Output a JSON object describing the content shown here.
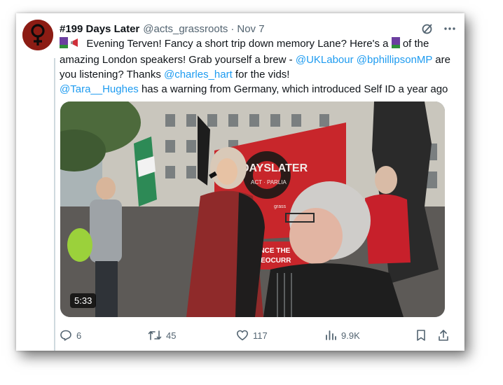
{
  "tweet": {
    "author_name": "#199 Days Later",
    "handle": "@acts_grassroots",
    "separator": "·",
    "date": "Nov 7",
    "text": {
      "l1_a": "Evening Terven! Fancy a short trip down memory Lane? Here's a ",
      "l1_b": " of the",
      "l2_a": "amazing London speakers! Grab yourself a brew - ",
      "l2_link1": "@UKLabour",
      "l2_link2": "@bphillipsonMP",
      "l2_b": " are",
      "l3_a": "you listening? Thanks ",
      "l3_link": "@charles_hart",
      "l3_b": " for the vids!",
      "l4_link": "@Tara__Hughes",
      "l4_b": " has a warning from Germany, which introduced Self ID a year ago"
    },
    "media": {
      "duration": "5:33",
      "banner_text": "DAYSLATER",
      "banner_sub": "ACT · PARLIA",
      "placard_text": "SINCE THE",
      "placard_text2": "IMEOCURR",
      "small_label": "grass"
    },
    "actions": {
      "replies": "6",
      "reposts": "45",
      "likes": "117",
      "views": "9.9K"
    }
  },
  "colors": {
    "link": "#1d9bf0",
    "muted": "#536471",
    "avatar_bg": "#8c1c14",
    "banner_red": "#c8262b"
  },
  "icons": [
    "venus-icon",
    "grok-icon",
    "more-icon",
    "purple-flag-emoji",
    "megaphone-emoji",
    "reply-icon",
    "repost-icon",
    "like-icon",
    "views-icon",
    "bookmark-icon",
    "share-icon"
  ]
}
